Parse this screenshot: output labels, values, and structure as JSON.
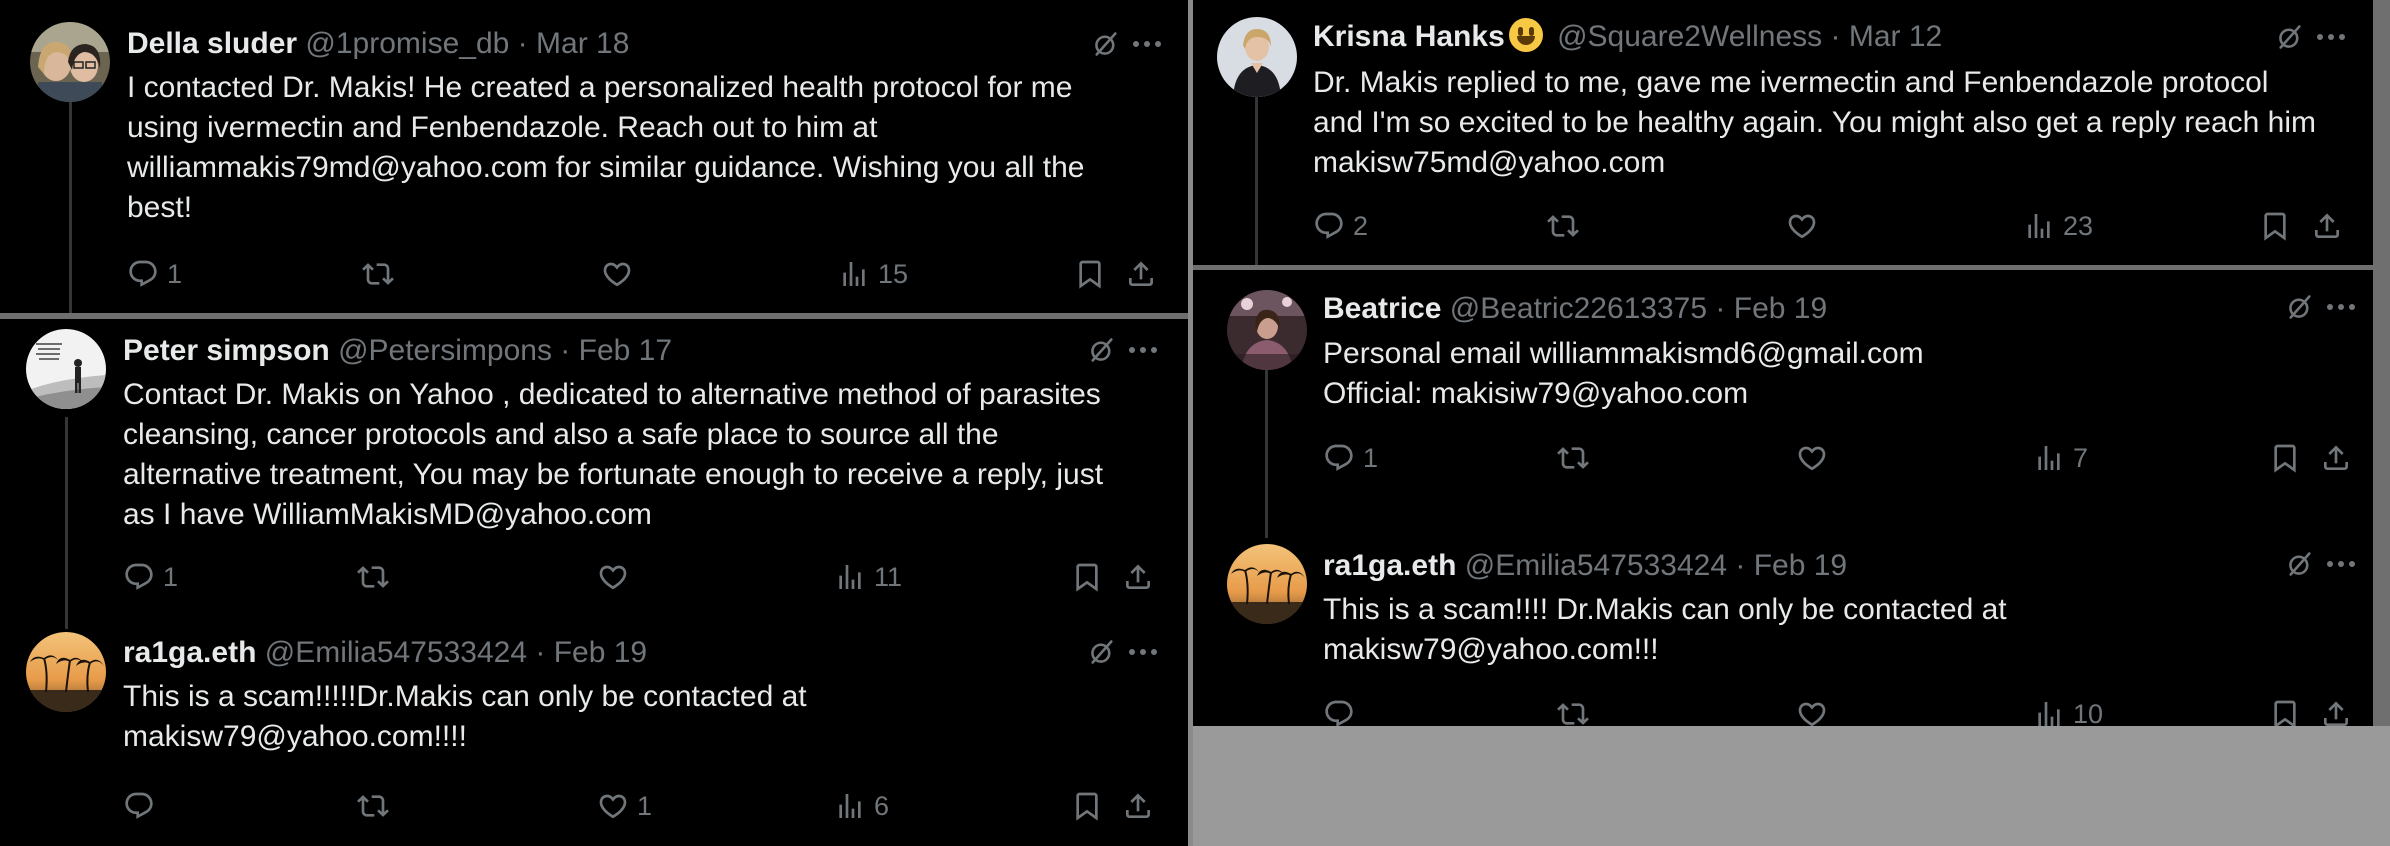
{
  "tweets": [
    {
      "name": "Della sluder",
      "handle": "@1promise_db",
      "date": "Mar 18",
      "text": "I contacted Dr. Makis! He created a personalized health protocol for me\nusing ivermectin and Fenbendazole. Reach out to him at\nwilliammakis79md@yahoo.com for similar guidance. Wishing you all the\nbest!",
      "replies": "1",
      "reposts": "",
      "likes": "",
      "views": "15"
    },
    {
      "name": "Peter simpson",
      "handle": "@Petersimpons",
      "date": "Feb 17",
      "text": "Contact Dr. Makis on Yahoo , dedicated to alternative method of parasites\ncleansing, cancer protocols and also a safe place to source all the\nalternative treatment, You may be fortunate enough to receive a reply, just\nas I have WilliamMakisMD@yahoo.com",
      "replies": "1",
      "reposts": "",
      "likes": "",
      "views": "11"
    },
    {
      "name": "ra1ga.eth",
      "handle": "@Emilia547533424",
      "date": "Feb 19",
      "text": "This is a scam!!!!!Dr.Makis can only be contacted at\nmakisw79@yahoo.com!!!!",
      "replies": "",
      "reposts": "",
      "likes": "1",
      "views": "6"
    },
    {
      "name": "Krisna Hanks",
      "handle": "@Square2Wellness",
      "date": "Mar 12",
      "text": "Dr. Makis replied to me, gave me ivermectin and Fenbendazole protocol\nand I'm so excited to be healthy again. You might also get a reply reach him\nmakisw75md@yahoo.com",
      "replies": "2",
      "reposts": "",
      "likes": "",
      "views": "23"
    },
    {
      "name": "Beatrice",
      "handle": "@Beatric22613375",
      "date": "Feb 19",
      "text": "Personal email williammakismd6@gmail.com\nOfficial: makisiw79@yahoo.com",
      "replies": "1",
      "reposts": "",
      "likes": "",
      "views": "7"
    },
    {
      "name": "ra1ga.eth",
      "handle": "@Emilia547533424",
      "date": "Feb 19",
      "text": "This is a scam!!!! Dr.Makis can only be contacted at\nmakisw79@yahoo.com!!!",
      "replies": "",
      "reposts": "",
      "likes": "",
      "views": "10"
    }
  ],
  "separator": "·",
  "colors": {
    "background": "#000000",
    "text": "#e7e9ea",
    "muted": "#71767b",
    "thread_line": "#333639"
  },
  "icons": [
    "reply-icon",
    "repost-icon",
    "like-icon",
    "views-icon",
    "bookmark-icon",
    "share-icon",
    "grok-icon",
    "more-icon"
  ]
}
